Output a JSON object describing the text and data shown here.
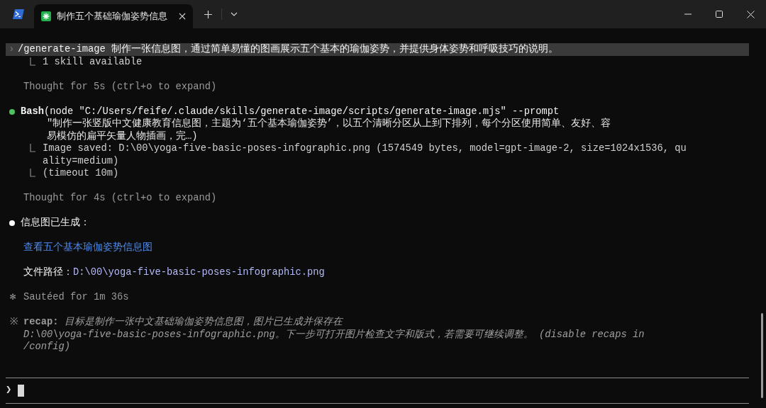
{
  "tab": {
    "title": "制作五个基础瑜伽姿势信息"
  },
  "transcript": [
    {
      "kind": "prompt",
      "glyph": "›",
      "command": "/generate-image",
      "text": "制作一张信息图，通过简单易懂的图画展示五个基本的瑜伽姿势，并提供身体姿势和呼吸技巧的说明。"
    },
    {
      "kind": "result",
      "lines": [
        "1 skill available"
      ]
    },
    {
      "kind": "thought",
      "text": "Thought for 5s (ctrl+o to expand)"
    },
    {
      "kind": "tool",
      "color": "#4ec35a",
      "name": "Bash",
      "lines": [
        "(node \"C:/Users/feife/.claude/skills/generate-image/scripts/generate-image.mjs\" --prompt",
        "\"制作一张竖版中文健康教育信息图，主题为‘五个基本瑜伽姿势’，以五个清晰分区从上到下排列，每个分区使用简单、友好、容",
        "易模仿的扁平矢量人物插画，完…)"
      ]
    },
    {
      "kind": "result",
      "lines": [
        "Image saved: D:\\00\\yoga-five-basic-poses-infographic.png (1574549 bytes, model=gpt-image-2, size=1024x1536, qu",
        "ality=medium)"
      ]
    },
    {
      "kind": "result",
      "lines": [
        "(timeout 10m)"
      ]
    },
    {
      "kind": "thought",
      "text": "Thought for 4s (ctrl+o to expand)"
    },
    {
      "kind": "message",
      "color": "#ffffff",
      "text": "信息图已生成："
    },
    {
      "kind": "link",
      "text": "查看五个基本瑜伽姿势信息图"
    },
    {
      "kind": "path",
      "label": "文件路径：",
      "path": "D:\\00\\yoga-five-basic-poses-infographic.png"
    },
    {
      "kind": "status",
      "glyph": "✻",
      "text": "Sautéed for 1m 36s"
    },
    {
      "kind": "recap",
      "glyph": "※",
      "label": "recap:",
      "lines": [
        "目标是制作一张中文基础瑜伽姿势信息图，图片已生成并保存在",
        "D:\\00\\yoga-five-basic-poses-infographic.png。下一步可打开图片检查文字和版式，若需要可继续调整。 (disable recaps in",
        "/config)"
      ]
    }
  ],
  "input": {
    "glyph": "❯"
  }
}
